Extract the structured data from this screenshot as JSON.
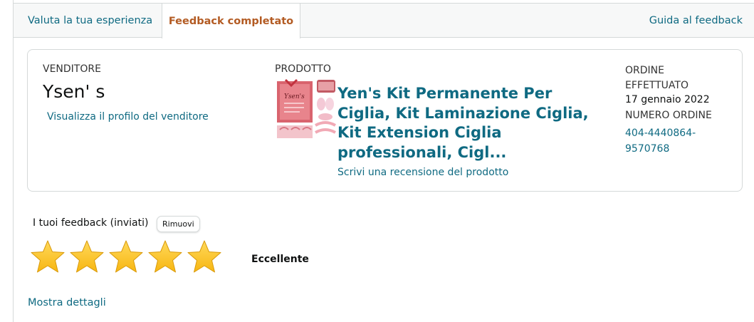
{
  "tabs": {
    "rate_label": "Valuta la tua esperienza",
    "done_label": "Feedback completato",
    "guide_label": "Guida al feedback"
  },
  "seller": {
    "label": "VENDITORE",
    "name": "Ysen' s",
    "profile_link": "Visualizza il profilo del venditore"
  },
  "product": {
    "label": "PRODOTTO",
    "title": "Yen's Kit Permanente Per Ciglia, Kit Laminazione Ciglia, Kit Extension Ciglia professionali, Cigl...",
    "review_link": "Scrivi una recensione del prodotto",
    "image_text": "Ysen's"
  },
  "order": {
    "placed_label": "ORDINE EFFETTUATO",
    "date": "17 gennaio 2022",
    "number_label": "NUMERO ORDINE",
    "number": "404-4440864-9570768"
  },
  "feedback": {
    "label": "I tuoi feedback (inviati)",
    "remove_label": "Rimuovi",
    "rating": 5,
    "rating_max": 5,
    "rating_text": "Eccellente",
    "details_link": "Mostra dettagli"
  },
  "colors": {
    "link": "#0f6a82",
    "active_tab": "#b35b23",
    "star": "#f7b612"
  }
}
